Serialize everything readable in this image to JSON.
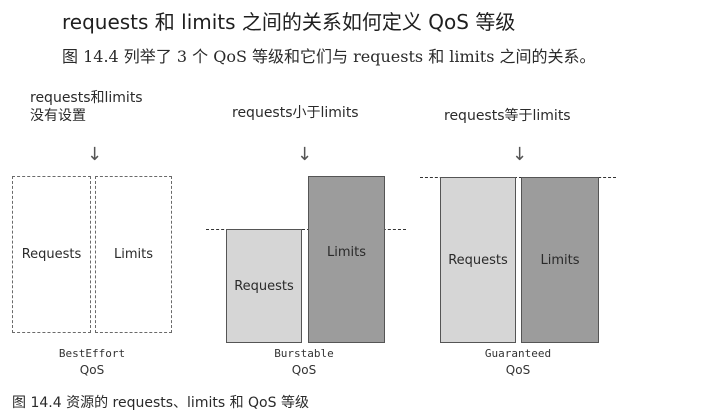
{
  "heading": "requests 和 limits 之间的关系如何定义 QoS 等级",
  "intro": "图 14.4 列举了 3 个 QoS 等级和它们与 requests 和 limits 之间的关系。",
  "groups": [
    {
      "annotation_line1": "requests和limits",
      "annotation_line2": "没有设置",
      "requests_label": "Requests",
      "limits_label": "Limits",
      "class_name": "BestEffort",
      "qos_label": "QoS"
    },
    {
      "annotation_line1": "requests小于limits",
      "requests_label": "Requests",
      "limits_label": "Limits",
      "class_name": "Burstable",
      "qos_label": "QoS"
    },
    {
      "annotation_line1": "requests等于limits",
      "requests_label": "Requests",
      "limits_label": "Limits",
      "class_name": "Guaranteed",
      "qos_label": "QoS"
    }
  ],
  "arrow_glyph": "↓",
  "figure_caption": "图 14.4   资源的 requests、limits 和 QoS 等级",
  "colors": {
    "requests_fill": "#d6d6d6",
    "limits_fill": "#9c9c9c"
  }
}
